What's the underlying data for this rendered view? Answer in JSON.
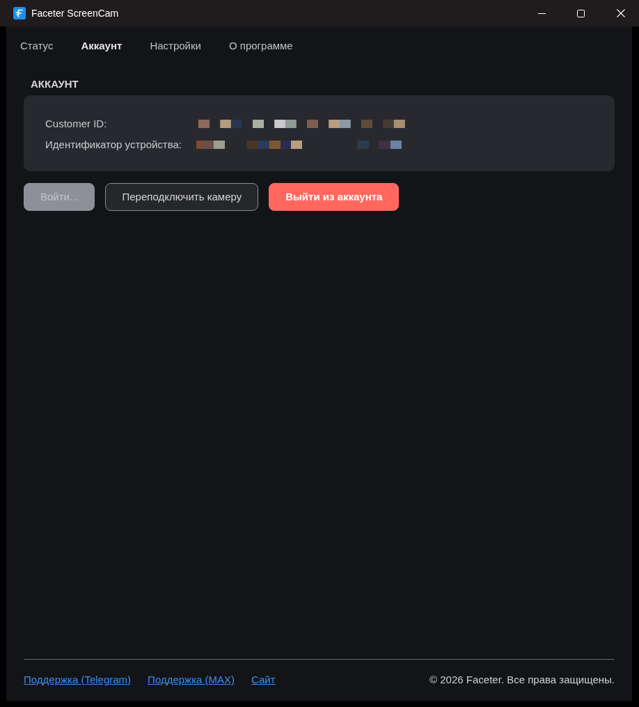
{
  "window": {
    "title": "Faceter ScreenCam"
  },
  "tabs": [
    {
      "label": "Статус",
      "selected": false
    },
    {
      "label": "Аккаунт",
      "selected": true
    },
    {
      "label": "Настройки",
      "selected": false
    },
    {
      "label": "О программе",
      "selected": false
    }
  ],
  "account": {
    "heading": "АККАУНТ",
    "fields": [
      {
        "label": "Customer ID:"
      },
      {
        "label": "Идентификатор устройства:"
      }
    ]
  },
  "buttons": [
    {
      "label": "Войти...",
      "kind": "filled",
      "disabled": true
    },
    {
      "label": "Переподключить камеру",
      "kind": "outline",
      "disabled": false
    },
    {
      "label": "Выйти из аккаунта",
      "kind": "danger",
      "disabled": false
    }
  ],
  "footer": {
    "links": [
      "Поддержка (Telegram)",
      "Поддержка (MAX)",
      "Сайт"
    ],
    "copyright": "© 2026 Faceter. Все права защищены."
  }
}
